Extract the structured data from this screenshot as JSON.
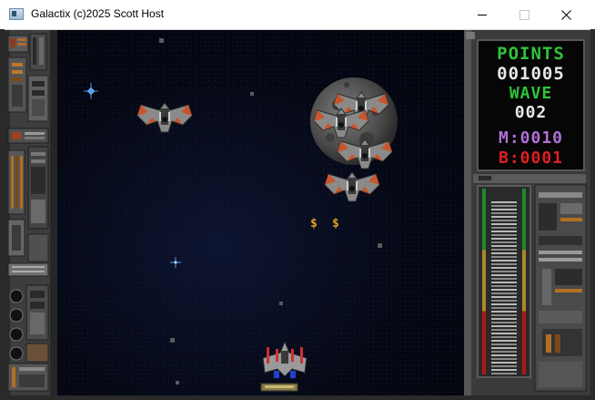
{
  "window": {
    "title": "Galactix (c)2025 Scott Host",
    "controls": {
      "minimize": "minimize",
      "maximize": "maximize",
      "close": "close"
    }
  },
  "hud": {
    "points_label": "POINTS",
    "points_value": "001005",
    "wave_label": "WAVE",
    "wave_value": "002",
    "m_counter": "M:0010",
    "b_counter": "B:0001"
  },
  "gauges": {
    "left_bar": 1.0,
    "right_bar": 1.0
  },
  "colors": {
    "label_green": "#2ec43a",
    "value_white": "#e8e8e8",
    "m_purple": "#b070d8",
    "b_red": "#e02020",
    "space_dark": "#050814"
  },
  "scene": {
    "enemies": 5,
    "bonus_pickups": [
      "$",
      "$"
    ],
    "player_ship": "player-fighter",
    "planet": "cratered-moon"
  }
}
